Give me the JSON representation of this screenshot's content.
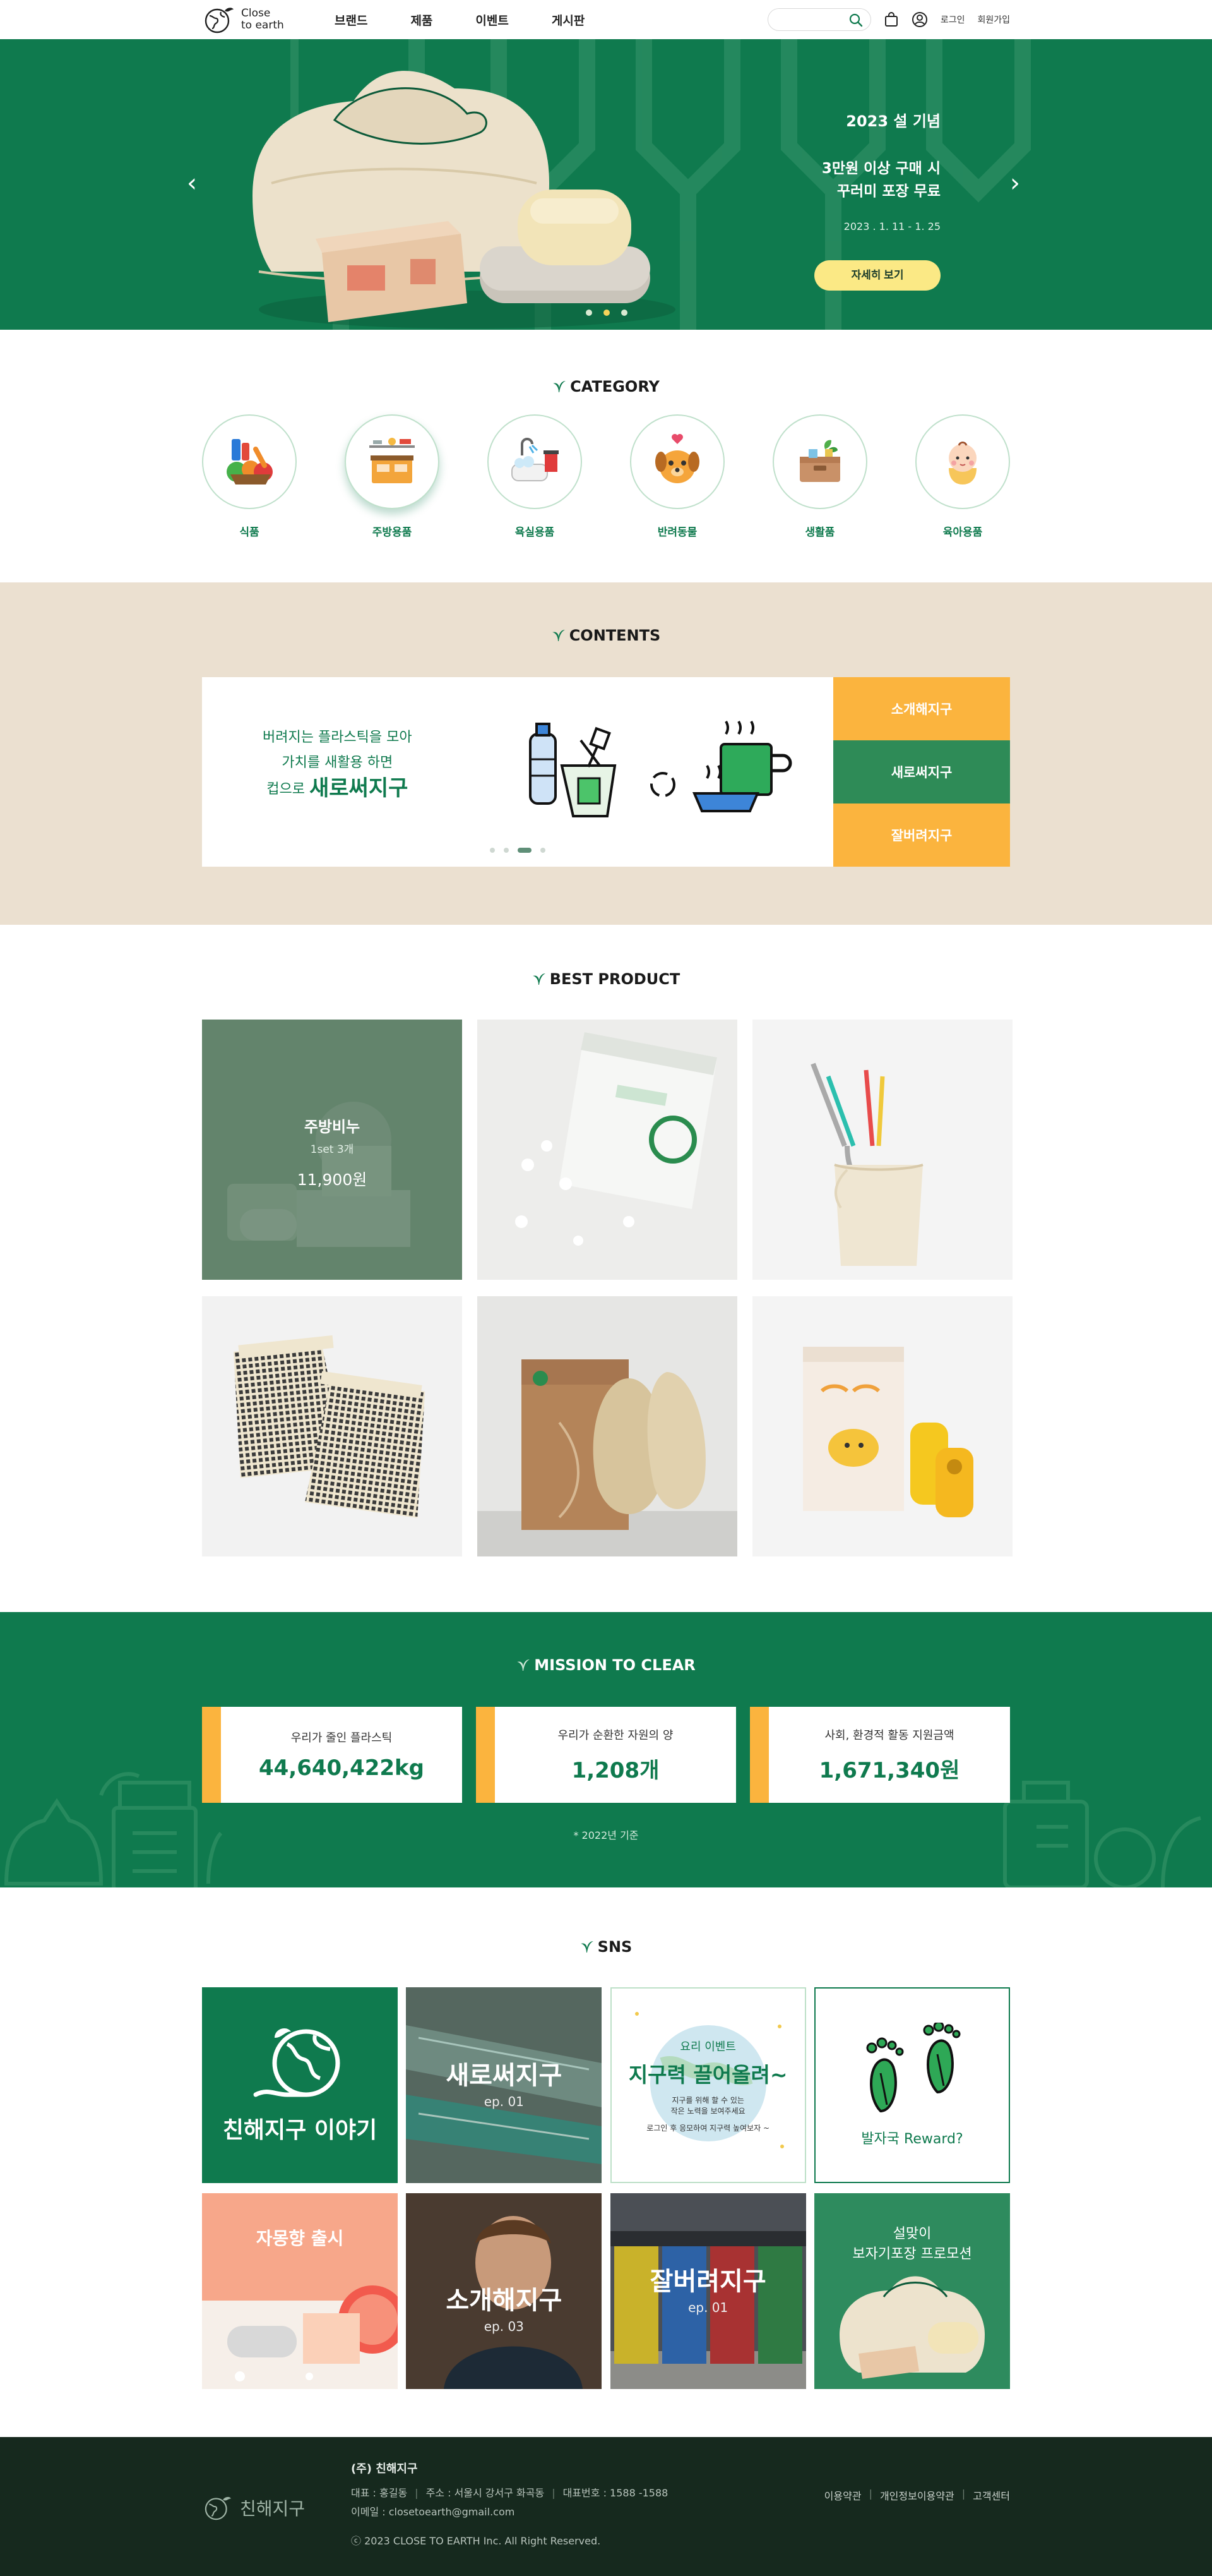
{
  "header": {
    "logo": "Close to earth",
    "logo_line1": "Close",
    "logo_line2": "to earth",
    "nav": [
      "브랜드",
      "제품",
      "이벤트",
      "게시판"
    ],
    "search_placeholder": "",
    "login": "로그인",
    "signup": "회원가입"
  },
  "hero": {
    "eyebrow": "2023 설 기념",
    "headline_line1": "3만원 이상 구매 시",
    "headline_line2": "꾸러미 포장 무료",
    "date": "2023 . 1. 11 - 1. 25",
    "button": "자세히 보기",
    "prev": "‹",
    "next": "›",
    "slide_count": 3,
    "active_slide": 2
  },
  "category": {
    "title": "CATEGORY",
    "items": [
      {
        "label": "식품",
        "icon": "food-icon"
      },
      {
        "label": "주방용품",
        "icon": "kitchen-icon"
      },
      {
        "label": "욕실용품",
        "icon": "bath-icon"
      },
      {
        "label": "반려동물",
        "icon": "pet-icon"
      },
      {
        "label": "생활품",
        "icon": "living-icon"
      },
      {
        "label": "육아용품",
        "icon": "baby-icon"
      }
    ],
    "active_index": 1
  },
  "contents": {
    "title": "CONTENTS",
    "copy_line1": "버려지는 플라스틱을 모아",
    "copy_line2": "가치를 새활용 하면",
    "copy_line3_prefix": "컵으로",
    "copy_line3_big": "새로써지구",
    "tabs": [
      "소개해지구",
      "새로써지구",
      "잘버려지구"
    ],
    "active_tab": 1,
    "dot_count": 4,
    "active_dot": 2
  },
  "best": {
    "title": "BEST PRODUCT",
    "featured": {
      "name": "주방비누",
      "set": "1set 3개",
      "price": "11,900원"
    },
    "products": [
      "soap",
      "tablet-pouch",
      "straw-set",
      "mesh-bag",
      "scrubber",
      "poop-bag"
    ]
  },
  "mission": {
    "title": "MISSION TO CLEAR",
    "stats": [
      {
        "label": "우리가 줄인 플라스틱",
        "value": "44,640,422kg"
      },
      {
        "label": "우리가 순환한 자원의 양",
        "value": "1,208개"
      },
      {
        "label": "사회, 환경적 활동 지원금액",
        "value": "1,671,340원"
      }
    ],
    "note": "* 2022년 기준"
  },
  "sns": {
    "title": "SNS",
    "cards": {
      "story": "친해지구 이야기",
      "resin_title": "새로써지구",
      "resin_ep": "ep. 01",
      "pull_badge": "요리 이벤트",
      "pull_title": "지구력 끌어올려~",
      "pull_desc1": "지구를 위해 할 수 있는",
      "pull_desc2": "작은 노력을 보여주세요",
      "pull_desc3": "로그인 후 응모하여 지구력 높여보자 ~",
      "foot_reward": "발자국 Reward?",
      "scent": "자몽향 출시",
      "intro_title": "소개해지구",
      "intro_ep": "ep. 03",
      "toss_title": "잘버려지구",
      "toss_ep": "ep. 01",
      "promo_line1": "설맞이",
      "promo_line2": "보자기포장 프로모션"
    }
  },
  "footer": {
    "logo": "친해지구",
    "company": "(주) 친해지구",
    "ceo": "대표 : 홍길동",
    "address": "주소 : 서울시 강서구 화곡동",
    "phone": "대표번호 : 1588 -1588",
    "email": "이메일 : closetoearth@gmail.com",
    "copyright": "ⓒ 2023 CLOSE TO EARTH Inc. All Right Reserved.",
    "links": [
      "이용약관",
      "개인정보이용약관",
      "고객센터"
    ]
  },
  "colors": {
    "brand_green": "#0f7a4e",
    "accent_yellow": "#fbb43e",
    "beige": "#ebe0d0",
    "footer_bg": "#16291e"
  }
}
